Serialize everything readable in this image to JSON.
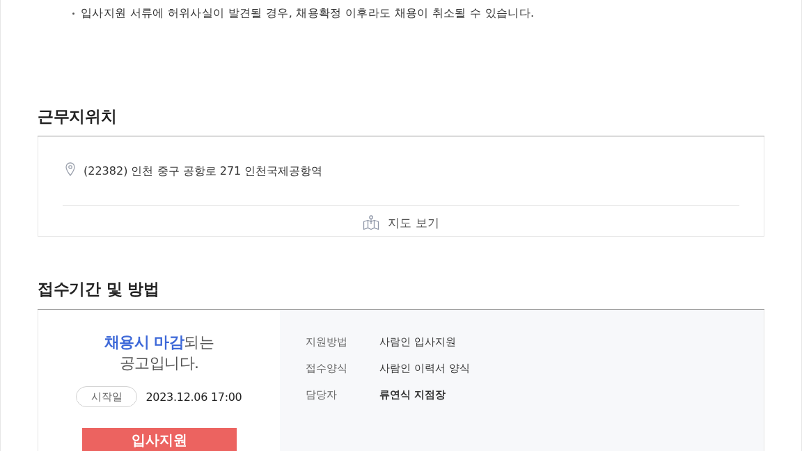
{
  "notes": [
    {
      "text": "입사지원 서류에 허위사실이 발견될 경우, 채용확정 이후라도 채용이 취소될 수 있습니다."
    }
  ],
  "location": {
    "title": "근무지위치",
    "address": "(22382) 인천 중구 공항로 271 인천국제공항역",
    "map_button": "지도 보기"
  },
  "application": {
    "title": "접수기간 및 방법",
    "headline": "**채용시 마감**되는 공고입니다.",
    "start_label": "시작일",
    "start_date": "2023.12.06 17:00",
    "apply_button": "입사지원",
    "details": [
      {
        "label": "지원방법",
        "value": "사람인 입사지원",
        "emphasized": false
      },
      {
        "label": "접수양식",
        "value": "사람인 이력서 양식",
        "emphasized": false
      },
      {
        "label": "담당자",
        "value": "류연식 지점장",
        "emphasized": true
      }
    ]
  }
}
